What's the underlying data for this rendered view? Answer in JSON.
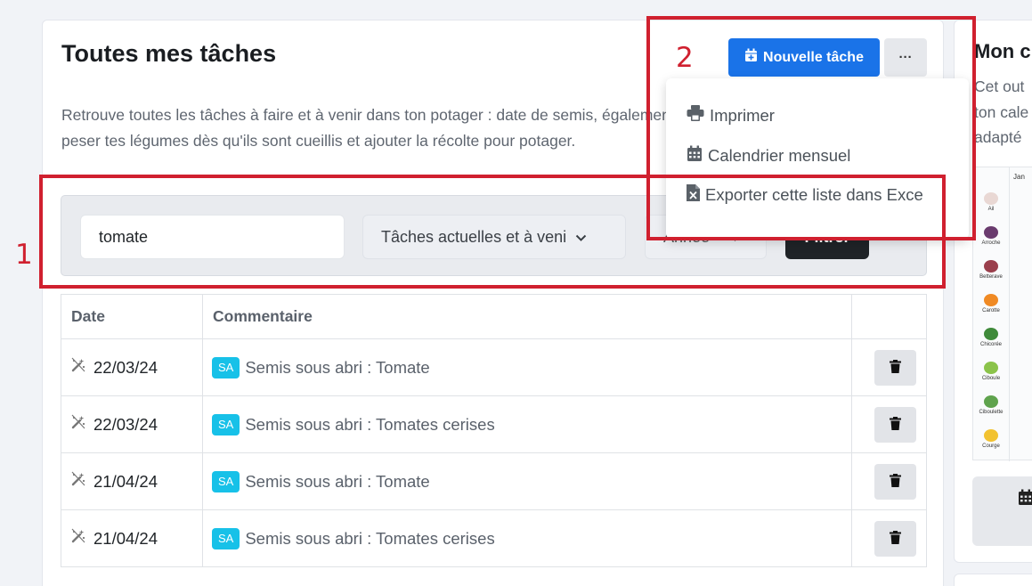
{
  "header": {
    "title": "Toutes mes tâches",
    "intro": "Retrouve toutes les tâches à faire et à venir dans ton potager : date de semis, également peser tes légumes dès qu'ils sont cueillis et ajouter la récolte pour potager.",
    "new_task_label": "Nouvelle tâche",
    "more_label": "···"
  },
  "filters": {
    "search_value": "tomate",
    "period_value": "Tâches actuelles et à veni",
    "year_value": "Année",
    "filter_button": "Filtrer"
  },
  "table": {
    "headers": [
      "Date",
      "Commentaire",
      ""
    ],
    "rows": [
      {
        "date": "22/03/24",
        "badge": "SA",
        "comment": "Semis sous abri : Tomate"
      },
      {
        "date": "22/03/24",
        "badge": "SA",
        "comment": "Semis sous abri : Tomates cerises"
      },
      {
        "date": "21/04/24",
        "badge": "SA",
        "comment": "Semis sous abri : Tomate"
      },
      {
        "date": "21/04/24",
        "badge": "SA",
        "comment": "Semis sous abri : Tomates cerises"
      }
    ]
  },
  "menu": {
    "items": [
      {
        "label": "Imprimer",
        "icon": "printer-icon"
      },
      {
        "label": "Calendrier mensuel",
        "icon": "calendar-icon"
      },
      {
        "label": "Exporter cette liste dans Exce",
        "icon": "excel-file-icon"
      }
    ]
  },
  "side": {
    "title": "Mon c",
    "text_lines": [
      "Cet out",
      "ton cale",
      "adapté"
    ],
    "calendar_month": "Jan",
    "vegetables": [
      "Ail",
      "Arroche",
      "Betterave",
      "Carotte",
      "Chicorée",
      "Ciboule",
      "Ciboulette",
      "Courge"
    ]
  },
  "annotations": [
    "1",
    "2"
  ],
  "colors": {
    "primary": "#1a73e8",
    "badge": "#17c1e8",
    "annotation": "#d0202f",
    "dark_button": "#1f2327"
  }
}
